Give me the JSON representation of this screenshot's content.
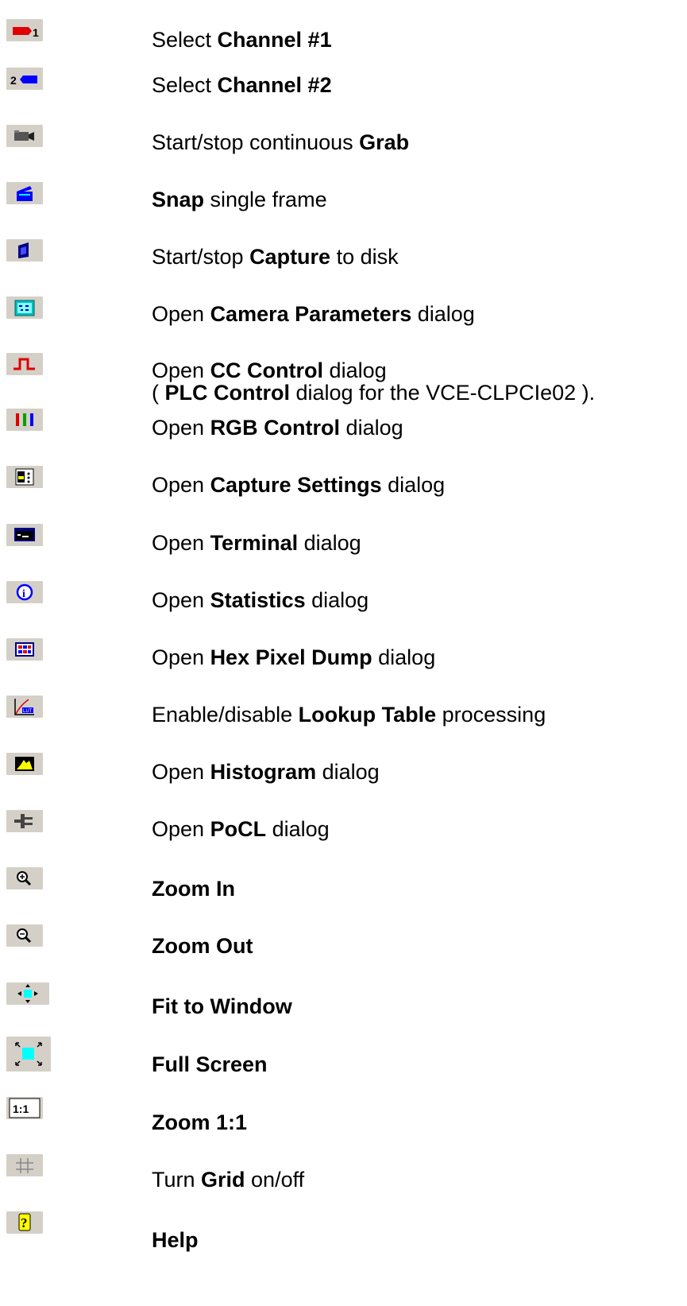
{
  "items": [
    {
      "pre": "Select ",
      "bold": "Channel #1",
      "post": "",
      "icon": "channel-1-icon"
    },
    {
      "pre": "Select ",
      "bold": "Channel #2",
      "post": "",
      "icon": "channel-2-icon"
    },
    {
      "pre": "Start/stop continuous ",
      "bold": "Grab",
      "post": "",
      "icon": "grab-camera-icon"
    },
    {
      "pre": "",
      "bold": "Snap",
      "post": " single frame",
      "icon": "snap-icon"
    },
    {
      "pre": "Start/stop ",
      "bold": "Capture",
      "post": " to disk",
      "icon": "capture-icon"
    },
    {
      "pre": "Open ",
      "bold": "Camera Parameters",
      "post": " dialog",
      "icon": "camera-parameters-icon"
    },
    {
      "pre": "Open ",
      "bold": "CC Control",
      "post": " dialog",
      "icon": "cc-control-icon",
      "line2": {
        "pre": "( ",
        "bold": "PLC Control",
        "post": " dialog for the VCE-CLPCIe02 )."
      }
    },
    {
      "pre": "Open ",
      "bold": "RGB Control",
      "post": " dialog",
      "icon": "rgb-control-icon"
    },
    {
      "pre": "Open ",
      "bold": "Capture Settings",
      "post": " dialog",
      "icon": "capture-settings-icon"
    },
    {
      "pre": "Open ",
      "bold": "Terminal",
      "post": " dialog",
      "icon": "terminal-icon"
    },
    {
      "pre": "Open ",
      "bold": "Statistics",
      "post": " dialog",
      "icon": "statistics-icon"
    },
    {
      "pre": "Open ",
      "bold": "Hex Pixel Dump",
      "post": " dialog",
      "icon": "hex-pixel-dump-icon"
    },
    {
      "pre": "Enable/disable ",
      "bold": "Lookup Table",
      "post": " processing",
      "icon": "lookup-table-icon"
    },
    {
      "pre": "Open ",
      "bold": "Histogram",
      "post": " dialog",
      "icon": "histogram-icon"
    },
    {
      "pre": "Open ",
      "bold": "PoCL",
      "post": " dialog",
      "icon": "pocl-icon"
    },
    {
      "pre": "",
      "bold": "Zoom In",
      "post": "",
      "icon": "zoom-in-icon"
    },
    {
      "pre": "",
      "bold": "Zoom Out",
      "post": "",
      "icon": "zoom-out-icon"
    },
    {
      "pre": "",
      "bold": "Fit to Window",
      "post": "",
      "icon": "fit-to-window-icon"
    },
    {
      "pre": "",
      "bold": "Full Screen",
      "post": "",
      "icon": "full-screen-icon"
    },
    {
      "pre": "",
      "bold": "Zoom 1:1",
      "post": "",
      "icon": "zoom-1-1-icon"
    },
    {
      "pre": "Turn ",
      "bold": "Grid",
      "post": " on/off",
      "icon": "grid-icon"
    },
    {
      "pre": "",
      "bold": "Help",
      "post": "",
      "icon": "help-icon"
    }
  ],
  "icon_glyphs": {
    "channel_1": "1",
    "channel_2": "2",
    "zoom_1_1": "1:1",
    "help": "?",
    "statistics": "i"
  },
  "colors": {
    "red": "#e00000",
    "blue": "#0000ff",
    "navy": "#000080",
    "cyan": "#00ffff",
    "yellow": "#ffff00",
    "face": "#d4d0c8"
  }
}
